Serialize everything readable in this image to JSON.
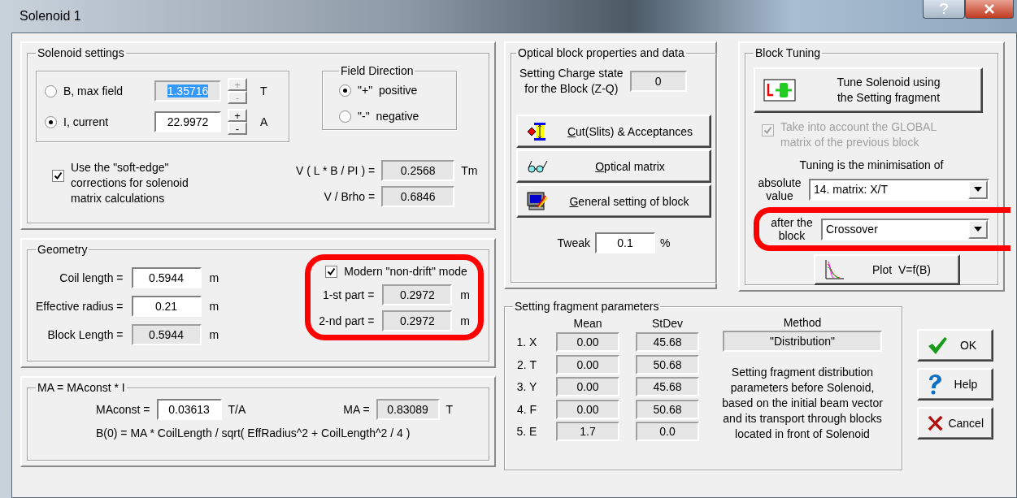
{
  "window": {
    "title": "Solenoid 1"
  },
  "solenoid_settings": {
    "title": "Solenoid settings",
    "modes": [
      {
        "label": "B, max field",
        "selected": false,
        "value": "1.35716",
        "text_selected": true,
        "editable": false,
        "spin_up": "+",
        "spin_down": "-",
        "unit": "T"
      },
      {
        "label": "I, current",
        "selected": true,
        "value": "22.9972",
        "text_selected": false,
        "editable": true,
        "spin_up": "+",
        "spin_down": "-",
        "unit": "A"
      }
    ],
    "field_direction": {
      "title": "Field Direction",
      "options": [
        {
          "label": "\"+\"  positive",
          "selected": true
        },
        {
          "label": "\"-\"  negative",
          "selected": false
        }
      ]
    },
    "soft_edge": {
      "label": "Use the \"soft-edge\"\ncorrections for solenoid\nmatrix calculations",
      "checked": true
    },
    "readouts": [
      {
        "label": "V ( L * B / PI ) =",
        "value": "0.2568",
        "unit": "Tm"
      },
      {
        "label": "V / Brho =",
        "value": "0.6846"
      }
    ]
  },
  "geometry": {
    "title": "Geometry",
    "fields": [
      {
        "label": "Coil length =",
        "value": "0.5944",
        "unit": "m",
        "editable": true
      },
      {
        "label": "Effective radius =",
        "value": "0.21",
        "unit": "m",
        "editable": true
      },
      {
        "label": "Block Length =",
        "value": "0.5944",
        "unit": "m",
        "editable": false
      }
    ],
    "non_drift": {
      "label": "Modern \"non-drift\" mode",
      "checked": true,
      "highlighted": true
    },
    "parts": [
      {
        "label": "1-st part =",
        "value": "0.2972",
        "unit": "m"
      },
      {
        "label": "2-nd part =",
        "value": "0.2972",
        "unit": "m"
      }
    ]
  },
  "ma": {
    "title": "MA = MAconst * I",
    "maconst": {
      "label": "MAconst =",
      "value": "0.03613",
      "unit": "T/A"
    },
    "ma": {
      "label": "MA =",
      "value": "0.83089",
      "unit": "T"
    },
    "formula": "B(0)  = MA * CoilLength / sqrt( EffRadius^2 + CoilLength^2 / 4 )"
  },
  "optical": {
    "title": "Optical block properties and data",
    "charge_label": "Setting Charge state\nfor the Block (Z-Q)",
    "charge_value": "0",
    "buttons": [
      {
        "kind": "slits",
        "label": "Cut(Slits) & Acceptances"
      },
      {
        "kind": "matrix",
        "label": "Optical matrix"
      },
      {
        "kind": "general",
        "label": "General setting of block"
      }
    ],
    "tweak": {
      "label": "Tweak",
      "value": "0.1",
      "unit": "%"
    }
  },
  "tuning": {
    "title": "Block Tuning",
    "tune_button": "Tune Solenoid using\nthe Setting fragment",
    "global": {
      "label": "Take into account the GLOBAL\nmatrix of the previous block",
      "checked": true,
      "disabled": true
    },
    "minimisation": "Tuning is the minimisation of",
    "rows": [
      {
        "label": "absolute\nvalue",
        "value": "14. matrix: X/T",
        "highlighted": false
      },
      {
        "label": "after the\nblock",
        "value": "Crossover",
        "highlighted": true
      }
    ],
    "plot_button": "Plot  V=f(B)"
  },
  "fragment": {
    "title": "Setting fragment parameters",
    "columns": [
      "Mean",
      "StDev",
      "Method"
    ],
    "rows": [
      {
        "label": "1. X",
        "mean": "0.00",
        "stdev": "45.68"
      },
      {
        "label": "2. T",
        "mean": "0.00",
        "stdev": "50.68"
      },
      {
        "label": "3. Y",
        "mean": "0.00",
        "stdev": "45.68"
      },
      {
        "label": "4. F",
        "mean": "0.00",
        "stdev": "50.68"
      },
      {
        "label": "5. E",
        "mean": "1.7",
        "stdev": "0.0"
      }
    ],
    "method": "\"Distribution\"",
    "description": "Setting fragment distribution\nparameters before Solenoid,\nbased on the initial beam vector\nand its transport through  blocks\nlocated in front of Solenoid"
  },
  "buttons": [
    {
      "kind": "ok",
      "label": "OK"
    },
    {
      "kind": "help",
      "label": "Help"
    },
    {
      "kind": "cancel",
      "label": "Cancel"
    }
  ]
}
